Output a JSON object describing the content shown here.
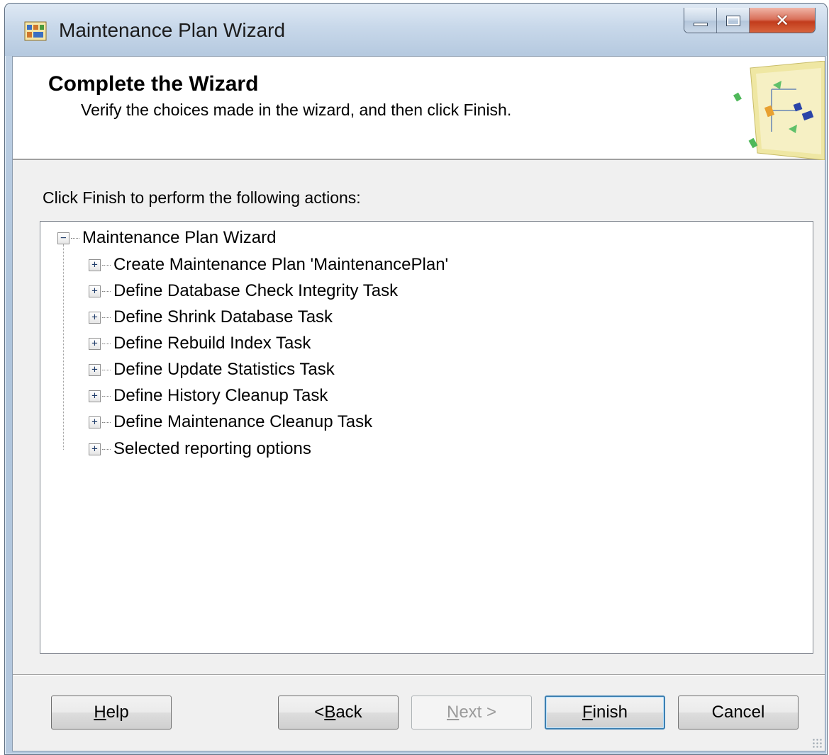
{
  "window": {
    "title": "Maintenance Plan Wizard",
    "caption_buttons": [
      "minimize",
      "maximize",
      "close"
    ]
  },
  "header": {
    "title": "Complete the Wizard",
    "subtitle": "Verify the choices made in the wizard, and then click Finish."
  },
  "instructions": "Click Finish to perform the following actions:",
  "tree": {
    "root": {
      "label": "Maintenance Plan Wizard",
      "expander": "−"
    },
    "items": [
      {
        "label": "Create Maintenance Plan 'MaintenancePlan'",
        "expander": "+"
      },
      {
        "label": "Define Database Check Integrity Task",
        "expander": "+"
      },
      {
        "label": "Define Shrink Database Task",
        "expander": "+"
      },
      {
        "label": "Define Rebuild Index Task",
        "expander": "+"
      },
      {
        "label": "Define Update Statistics Task",
        "expander": "+"
      },
      {
        "label": "Define History Cleanup Task",
        "expander": "+"
      },
      {
        "label": "Define Maintenance Cleanup Task",
        "expander": "+"
      },
      {
        "label": "Selected reporting options",
        "expander": "+"
      }
    ]
  },
  "buttons": {
    "help": {
      "prefix": "",
      "accel": "H",
      "rest": "elp"
    },
    "back": {
      "prefix": "< ",
      "accel": "B",
      "rest": "ack"
    },
    "next": {
      "prefix": "",
      "accel": "N",
      "rest": "ext >"
    },
    "finish": {
      "prefix": "",
      "accel": "F",
      "rest": "inish"
    },
    "cancel": {
      "label": "Cancel"
    }
  },
  "colors": {
    "title_bar": "#c8d8ea",
    "close_button": "#c23c1c",
    "default_button_border": "#3c7fb1"
  }
}
